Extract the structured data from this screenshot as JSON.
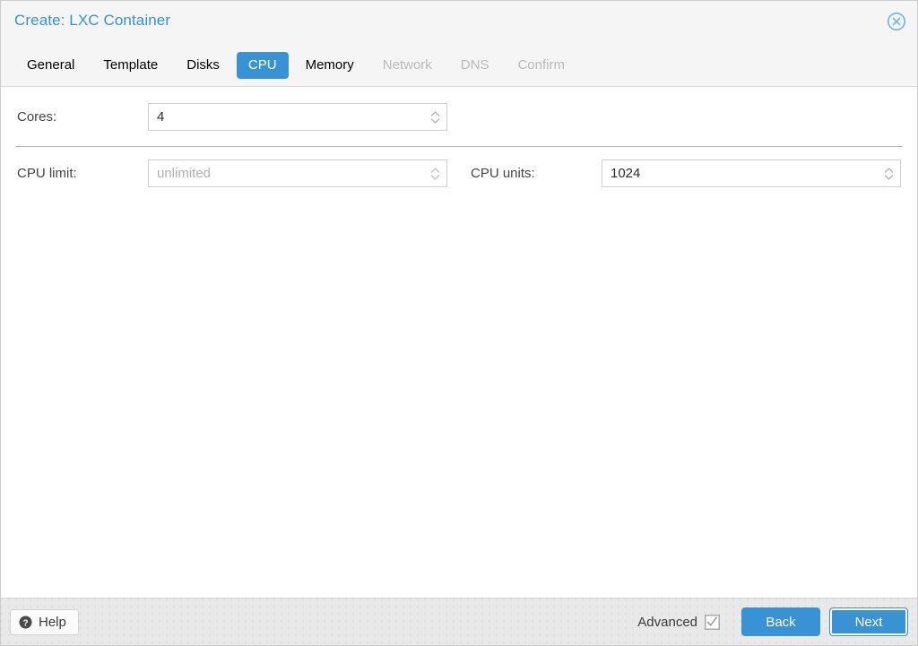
{
  "window": {
    "title": "Create: LXC Container",
    "close_icon": "close-circle-icon"
  },
  "tabs": [
    {
      "label": "General",
      "state": "enabled"
    },
    {
      "label": "Template",
      "state": "enabled"
    },
    {
      "label": "Disks",
      "state": "enabled"
    },
    {
      "label": "CPU",
      "state": "active"
    },
    {
      "label": "Memory",
      "state": "enabled"
    },
    {
      "label": "Network",
      "state": "disabled"
    },
    {
      "label": "DNS",
      "state": "disabled"
    },
    {
      "label": "Confirm",
      "state": "disabled"
    }
  ],
  "form": {
    "cores": {
      "label": "Cores:",
      "value": "4",
      "placeholder": "",
      "spinner_icon": "spinner-up-down-icon"
    },
    "cpu_limit": {
      "label": "CPU limit:",
      "value": "",
      "placeholder": "unlimited",
      "spinner_icon": "spinner-up-down-icon"
    },
    "cpu_units": {
      "label": "CPU units:",
      "value": "1024",
      "placeholder": "",
      "spinner_icon": "spinner-up-down-icon"
    }
  },
  "footer": {
    "help_label": "Help",
    "help_icon": "question-circle-icon",
    "advanced_label": "Advanced",
    "advanced_checked": true,
    "advanced_icon": "checkbox-checked-icon",
    "back_label": "Back",
    "next_label": "Next"
  },
  "colors": {
    "accent": "#3892d4",
    "header_bg": "#f5f5f5",
    "footer_bg": "#e9e9e9",
    "text": "#444444",
    "disabled_text": "#b9b9b9"
  }
}
